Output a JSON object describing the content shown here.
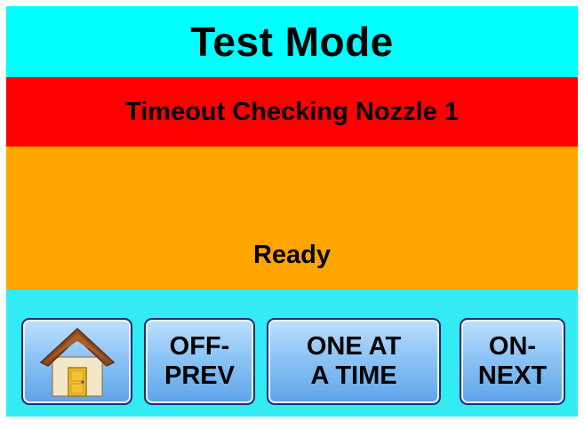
{
  "header": {
    "title": "Test Mode"
  },
  "alert": {
    "message": "Timeout Checking Nozzle 1"
  },
  "status": {
    "text": "Ready"
  },
  "buttons": {
    "home": {
      "icon": "home-icon"
    },
    "off_prev": {
      "line1": "OFF-",
      "line2": "PREV"
    },
    "one_at_a_time": {
      "line1": "ONE AT",
      "line2": "A TIME"
    },
    "on_next": {
      "line1": "ON-",
      "line2": "NEXT"
    }
  },
  "colors": {
    "header_bg": "#00ffff",
    "alert_bg": "#ff0000",
    "status_bg": "#ffa500",
    "button_bar_bg": "#33ebf2",
    "button_gradient_top": "#bfe0ff",
    "button_gradient_bottom": "#5ea4ea",
    "button_border": "#1c2a7a"
  }
}
